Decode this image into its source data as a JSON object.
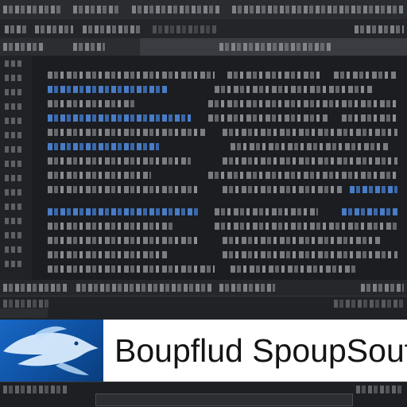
{
  "banner": {
    "title": "Boupflud SpoupSouf"
  },
  "colors": {
    "background": "#1b1d21",
    "accent": "#2f7bd6",
    "banner_background": "#ffffff",
    "logo_blue": "#1767c4"
  },
  "icons": {
    "logo": "fish-logo-icon",
    "active_indicator": "blue-dot-icon"
  }
}
